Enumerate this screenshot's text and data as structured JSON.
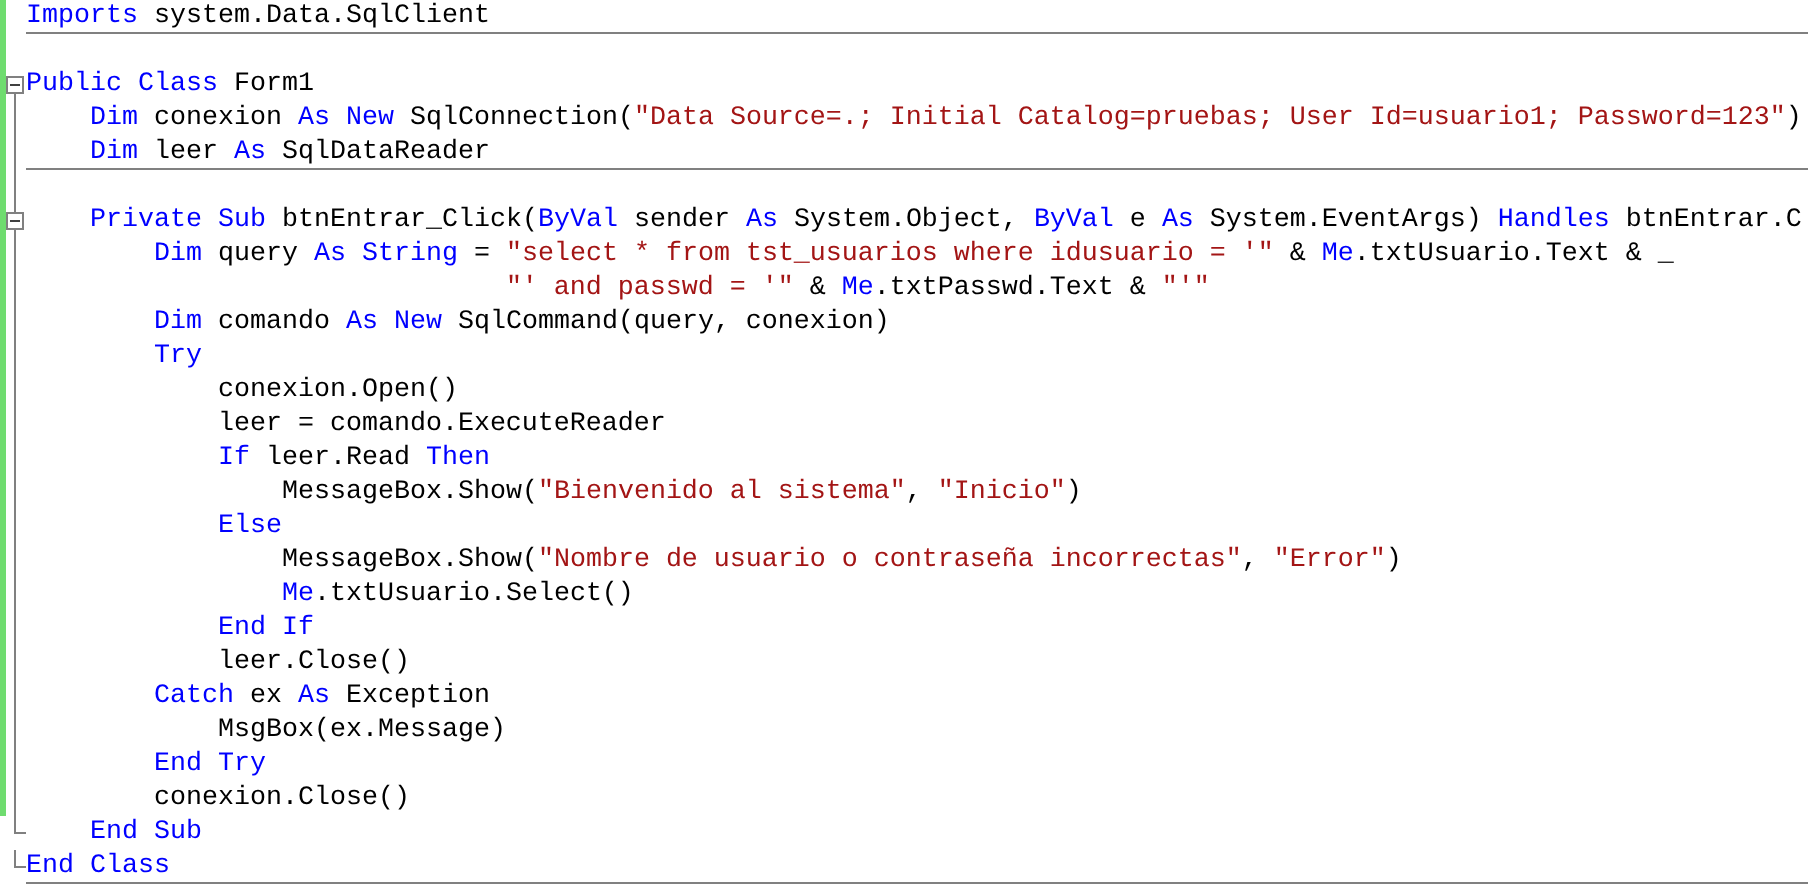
{
  "editor": {
    "lines": [
      {
        "kind": "code",
        "changed": true,
        "separator": true,
        "tokens": [
          {
            "kind": "keyword",
            "text": "Imports"
          },
          {
            "kind": "plain",
            "text": " system.Data.SqlClient"
          }
        ]
      },
      {
        "kind": "blank",
        "changed": true
      },
      {
        "kind": "fold_start",
        "changed": true,
        "tokens": [
          {
            "kind": "keyword",
            "text": "Public Class"
          },
          {
            "kind": "plain",
            "text": " Form1"
          }
        ],
        "children": [
          {
            "kind": "code",
            "changed": true,
            "tokens": [
              {
                "kind": "keyword",
                "text": "Dim"
              },
              {
                "kind": "plain",
                "text": " conexion "
              },
              {
                "kind": "keyword",
                "text": "As New"
              },
              {
                "kind": "plain",
                "text": " SqlConnection("
              },
              {
                "kind": "string",
                "text": "\"Data Source=.; Initial Catalog=pruebas; User Id=usuario1; Password=123\""
              },
              {
                "kind": "plain",
                "text": ")"
              }
            ]
          },
          {
            "kind": "code",
            "changed": true,
            "separator": true,
            "tokens": [
              {
                "kind": "keyword",
                "text": "Dim"
              },
              {
                "kind": "plain",
                "text": " leer "
              },
              {
                "kind": "keyword",
                "text": "As"
              },
              {
                "kind": "plain",
                "text": " SqlDataReader"
              }
            ]
          },
          {
            "kind": "blank",
            "changed": true
          },
          {
            "kind": "fold_start",
            "changed": true,
            "tokens": [
              {
                "kind": "keyword",
                "text": "Private Sub"
              },
              {
                "kind": "plain",
                "text": " btnEntrar_Click("
              },
              {
                "kind": "keyword",
                "text": "ByVal"
              },
              {
                "kind": "plain",
                "text": " sender "
              },
              {
                "kind": "keyword",
                "text": "As"
              },
              {
                "kind": "plain",
                "text": " System.Object, "
              },
              {
                "kind": "keyword",
                "text": "ByVal"
              },
              {
                "kind": "plain",
                "text": " e "
              },
              {
                "kind": "keyword",
                "text": "As"
              },
              {
                "kind": "plain",
                "text": " System.EventArgs) "
              },
              {
                "kind": "keyword",
                "text": "Handles"
              },
              {
                "kind": "plain",
                "text": " btnEntrar.C"
              }
            ],
            "children": [
              {
                "kind": "code",
                "changed": true,
                "tokens": [
                  {
                    "kind": "keyword",
                    "text": "Dim"
                  },
                  {
                    "kind": "plain",
                    "text": " query "
                  },
                  {
                    "kind": "keyword",
                    "text": "As String"
                  },
                  {
                    "kind": "plain",
                    "text": " = "
                  },
                  {
                    "kind": "string",
                    "text": "\"select * from tst_usuarios where idusuario = '\""
                  },
                  {
                    "kind": "plain",
                    "text": " & "
                  },
                  {
                    "kind": "keyword",
                    "text": "Me"
                  },
                  {
                    "kind": "plain",
                    "text": ".txtUsuario.Text & _"
                  }
                ],
                "children": [
                  {
                    "kind": "continuation",
                    "changed": true,
                    "tokens": [
                      {
                        "kind": "string",
                        "text": "\"' and passwd = '\""
                      },
                      {
                        "kind": "plain",
                        "text": " & "
                      },
                      {
                        "kind": "keyword",
                        "text": "Me"
                      },
                      {
                        "kind": "plain",
                        "text": ".txtPasswd.Text & "
                      },
                      {
                        "kind": "string",
                        "text": "\"'\""
                      }
                    ]
                  }
                ]
              },
              {
                "kind": "code",
                "changed": true,
                "tokens": [
                  {
                    "kind": "keyword",
                    "text": "Dim"
                  },
                  {
                    "kind": "plain",
                    "text": " comando "
                  },
                  {
                    "kind": "keyword",
                    "text": "As New"
                  },
                  {
                    "kind": "plain",
                    "text": " SqlCommand(query, conexion)"
                  }
                ]
              },
              {
                "kind": "code",
                "changed": true,
                "tokens": [
                  {
                    "kind": "keyword",
                    "text": "Try"
                  }
                ],
                "children": [
                  {
                    "kind": "code",
                    "changed": true,
                    "tokens": [
                      {
                        "kind": "plain",
                        "text": "conexion.Open()"
                      }
                    ]
                  },
                  {
                    "kind": "code",
                    "changed": true,
                    "tokens": [
                      {
                        "kind": "plain",
                        "text": "leer = comando.ExecuteReader"
                      }
                    ]
                  },
                  {
                    "kind": "code",
                    "changed": true,
                    "tokens": [
                      {
                        "kind": "keyword",
                        "text": "If"
                      },
                      {
                        "kind": "plain",
                        "text": " leer.Read "
                      },
                      {
                        "kind": "keyword",
                        "text": "Then"
                      }
                    ],
                    "children": [
                      {
                        "kind": "code",
                        "changed": true,
                        "tokens": [
                          {
                            "kind": "plain",
                            "text": "MessageBox.Show("
                          },
                          {
                            "kind": "string",
                            "text": "\"Bienvenido al sistema\""
                          },
                          {
                            "kind": "plain",
                            "text": ", "
                          },
                          {
                            "kind": "string",
                            "text": "\"Inicio\""
                          },
                          {
                            "kind": "plain",
                            "text": ")"
                          }
                        ]
                      }
                    ]
                  },
                  {
                    "kind": "code",
                    "changed": true,
                    "tokens": [
                      {
                        "kind": "keyword",
                        "text": "Else"
                      }
                    ],
                    "children": [
                      {
                        "kind": "code",
                        "changed": true,
                        "tokens": [
                          {
                            "kind": "plain",
                            "text": "MessageBox.Show("
                          },
                          {
                            "kind": "string",
                            "text": "\"Nombre de usuario o contraseña incorrectas\""
                          },
                          {
                            "kind": "plain",
                            "text": ", "
                          },
                          {
                            "kind": "string",
                            "text": "\"Error\""
                          },
                          {
                            "kind": "plain",
                            "text": ")"
                          }
                        ]
                      },
                      {
                        "kind": "code",
                        "changed": true,
                        "tokens": [
                          {
                            "kind": "keyword",
                            "text": "Me"
                          },
                          {
                            "kind": "plain",
                            "text": ".txtUsuario.Select()"
                          }
                        ]
                      }
                    ]
                  },
                  {
                    "kind": "code",
                    "changed": true,
                    "tokens": [
                      {
                        "kind": "keyword",
                        "text": "End If"
                      }
                    ]
                  },
                  {
                    "kind": "code",
                    "changed": true,
                    "tokens": [
                      {
                        "kind": "plain",
                        "text": "leer.Close()"
                      }
                    ]
                  }
                ]
              },
              {
                "kind": "code",
                "changed": true,
                "tokens": [
                  {
                    "kind": "keyword",
                    "text": "Catch"
                  },
                  {
                    "kind": "plain",
                    "text": " ex "
                  },
                  {
                    "kind": "keyword",
                    "text": "As"
                  },
                  {
                    "kind": "plain",
                    "text": " Exception"
                  }
                ],
                "children": [
                  {
                    "kind": "code",
                    "changed": true,
                    "tokens": [
                      {
                        "kind": "plain",
                        "text": "MsgBox(ex.Message)"
                      }
                    ]
                  }
                ]
              },
              {
                "kind": "code",
                "changed": true,
                "tokens": [
                  {
                    "kind": "keyword",
                    "text": "End Try"
                  }
                ]
              },
              {
                "kind": "code",
                "changed": true,
                "tokens": [
                  {
                    "kind": "plain",
                    "text": "conexion.Close()"
                  }
                ]
              }
            ]
          },
          {
            "kind": "fold_end",
            "changed": false,
            "tokens": [
              {
                "kind": "keyword",
                "text": "End Sub"
              }
            ]
          }
        ]
      },
      {
        "kind": "fold_end",
        "changed": false,
        "separator": true,
        "tokens": [
          {
            "kind": "keyword",
            "text": "End Class"
          }
        ]
      }
    ]
  }
}
